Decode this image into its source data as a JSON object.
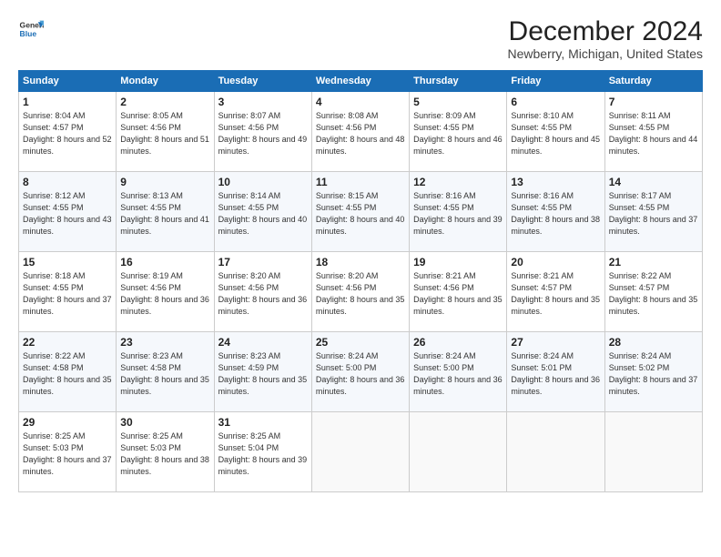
{
  "logo": {
    "line1": "General",
    "line2": "Blue"
  },
  "title": "December 2024",
  "subtitle": "Newberry, Michigan, United States",
  "header_color": "#1a6db5",
  "days_of_week": [
    "Sunday",
    "Monday",
    "Tuesday",
    "Wednesday",
    "Thursday",
    "Friday",
    "Saturday"
  ],
  "weeks": [
    [
      {
        "day": "1",
        "sunrise": "8:04 AM",
        "sunset": "4:57 PM",
        "daylight": "8 hours and 52 minutes."
      },
      {
        "day": "2",
        "sunrise": "8:05 AM",
        "sunset": "4:56 PM",
        "daylight": "8 hours and 51 minutes."
      },
      {
        "day": "3",
        "sunrise": "8:07 AM",
        "sunset": "4:56 PM",
        "daylight": "8 hours and 49 minutes."
      },
      {
        "day": "4",
        "sunrise": "8:08 AM",
        "sunset": "4:56 PM",
        "daylight": "8 hours and 48 minutes."
      },
      {
        "day": "5",
        "sunrise": "8:09 AM",
        "sunset": "4:55 PM",
        "daylight": "8 hours and 46 minutes."
      },
      {
        "day": "6",
        "sunrise": "8:10 AM",
        "sunset": "4:55 PM",
        "daylight": "8 hours and 45 minutes."
      },
      {
        "day": "7",
        "sunrise": "8:11 AM",
        "sunset": "4:55 PM",
        "daylight": "8 hours and 44 minutes."
      }
    ],
    [
      {
        "day": "8",
        "sunrise": "8:12 AM",
        "sunset": "4:55 PM",
        "daylight": "8 hours and 43 minutes."
      },
      {
        "day": "9",
        "sunrise": "8:13 AM",
        "sunset": "4:55 PM",
        "daylight": "8 hours and 41 minutes."
      },
      {
        "day": "10",
        "sunrise": "8:14 AM",
        "sunset": "4:55 PM",
        "daylight": "8 hours and 40 minutes."
      },
      {
        "day": "11",
        "sunrise": "8:15 AM",
        "sunset": "4:55 PM",
        "daylight": "8 hours and 40 minutes."
      },
      {
        "day": "12",
        "sunrise": "8:16 AM",
        "sunset": "4:55 PM",
        "daylight": "8 hours and 39 minutes."
      },
      {
        "day": "13",
        "sunrise": "8:16 AM",
        "sunset": "4:55 PM",
        "daylight": "8 hours and 38 minutes."
      },
      {
        "day": "14",
        "sunrise": "8:17 AM",
        "sunset": "4:55 PM",
        "daylight": "8 hours and 37 minutes."
      }
    ],
    [
      {
        "day": "15",
        "sunrise": "8:18 AM",
        "sunset": "4:55 PM",
        "daylight": "8 hours and 37 minutes."
      },
      {
        "day": "16",
        "sunrise": "8:19 AM",
        "sunset": "4:56 PM",
        "daylight": "8 hours and 36 minutes."
      },
      {
        "day": "17",
        "sunrise": "8:20 AM",
        "sunset": "4:56 PM",
        "daylight": "8 hours and 36 minutes."
      },
      {
        "day": "18",
        "sunrise": "8:20 AM",
        "sunset": "4:56 PM",
        "daylight": "8 hours and 35 minutes."
      },
      {
        "day": "19",
        "sunrise": "8:21 AM",
        "sunset": "4:56 PM",
        "daylight": "8 hours and 35 minutes."
      },
      {
        "day": "20",
        "sunrise": "8:21 AM",
        "sunset": "4:57 PM",
        "daylight": "8 hours and 35 minutes."
      },
      {
        "day": "21",
        "sunrise": "8:22 AM",
        "sunset": "4:57 PM",
        "daylight": "8 hours and 35 minutes."
      }
    ],
    [
      {
        "day": "22",
        "sunrise": "8:22 AM",
        "sunset": "4:58 PM",
        "daylight": "8 hours and 35 minutes."
      },
      {
        "day": "23",
        "sunrise": "8:23 AM",
        "sunset": "4:58 PM",
        "daylight": "8 hours and 35 minutes."
      },
      {
        "day": "24",
        "sunrise": "8:23 AM",
        "sunset": "4:59 PM",
        "daylight": "8 hours and 35 minutes."
      },
      {
        "day": "25",
        "sunrise": "8:24 AM",
        "sunset": "5:00 PM",
        "daylight": "8 hours and 36 minutes."
      },
      {
        "day": "26",
        "sunrise": "8:24 AM",
        "sunset": "5:00 PM",
        "daylight": "8 hours and 36 minutes."
      },
      {
        "day": "27",
        "sunrise": "8:24 AM",
        "sunset": "5:01 PM",
        "daylight": "8 hours and 36 minutes."
      },
      {
        "day": "28",
        "sunrise": "8:24 AM",
        "sunset": "5:02 PM",
        "daylight": "8 hours and 37 minutes."
      }
    ],
    [
      {
        "day": "29",
        "sunrise": "8:25 AM",
        "sunset": "5:03 PM",
        "daylight": "8 hours and 37 minutes."
      },
      {
        "day": "30",
        "sunrise": "8:25 AM",
        "sunset": "5:03 PM",
        "daylight": "8 hours and 38 minutes."
      },
      {
        "day": "31",
        "sunrise": "8:25 AM",
        "sunset": "5:04 PM",
        "daylight": "8 hours and 39 minutes."
      },
      null,
      null,
      null,
      null
    ]
  ]
}
